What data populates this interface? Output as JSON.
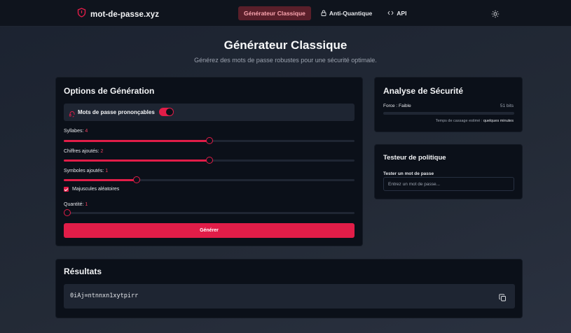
{
  "header": {
    "brand_name": "mot-de-passe.xyz",
    "brand_icon": "shield-icon",
    "nav": [
      {
        "label": "Générateur Classique",
        "active": true
      },
      {
        "label": "Anti-Quantique",
        "icon": "lock-icon"
      },
      {
        "label": "API",
        "icon": "code-icon"
      }
    ],
    "theme_icon": "sun-icon"
  },
  "page": {
    "title": "Générateur Classique",
    "subtitle": "Générez des mots de passe robustes pour une sécurité optimale."
  },
  "options": {
    "title": "Options de Génération",
    "pronounceable": {
      "label": "Mots de passe prononçables",
      "icon": "headset-icon",
      "enabled": true
    },
    "syllables": {
      "label": "Syllabes:",
      "value": "4",
      "fill_fraction": 0.5
    },
    "digits": {
      "label": "Chiffres ajoutés:",
      "value": "2",
      "fill_fraction": 0.5
    },
    "symbols": {
      "label": "Symboles ajoutés:",
      "value": "1",
      "fill_fraction": 0.25
    },
    "uppercase": {
      "label": "Majuscules aléatoires",
      "checked": true
    },
    "quantity": {
      "label": "Quantité:",
      "value": "1",
      "fill_fraction": 0.0
    },
    "generate_label": "Générer"
  },
  "analysis": {
    "title": "Analyse de Sécurité",
    "strength_label": "Force : Faible",
    "bits": "51 bits",
    "crack_prefix": "Temps de cassage estimé :",
    "crack_value": "quelques minutes"
  },
  "policy": {
    "title": "Testeur de politique",
    "label": "Tester un mot de passe",
    "placeholder": "Entrez un mot de passe..."
  },
  "results": {
    "title": "Résultats",
    "password": "0iAj=ntnnxn1xytpirr",
    "copy_icon": "copy-icon"
  },
  "colors": {
    "accent": "#e11d48",
    "background": "#1b2230",
    "card": "#0b1019"
  }
}
